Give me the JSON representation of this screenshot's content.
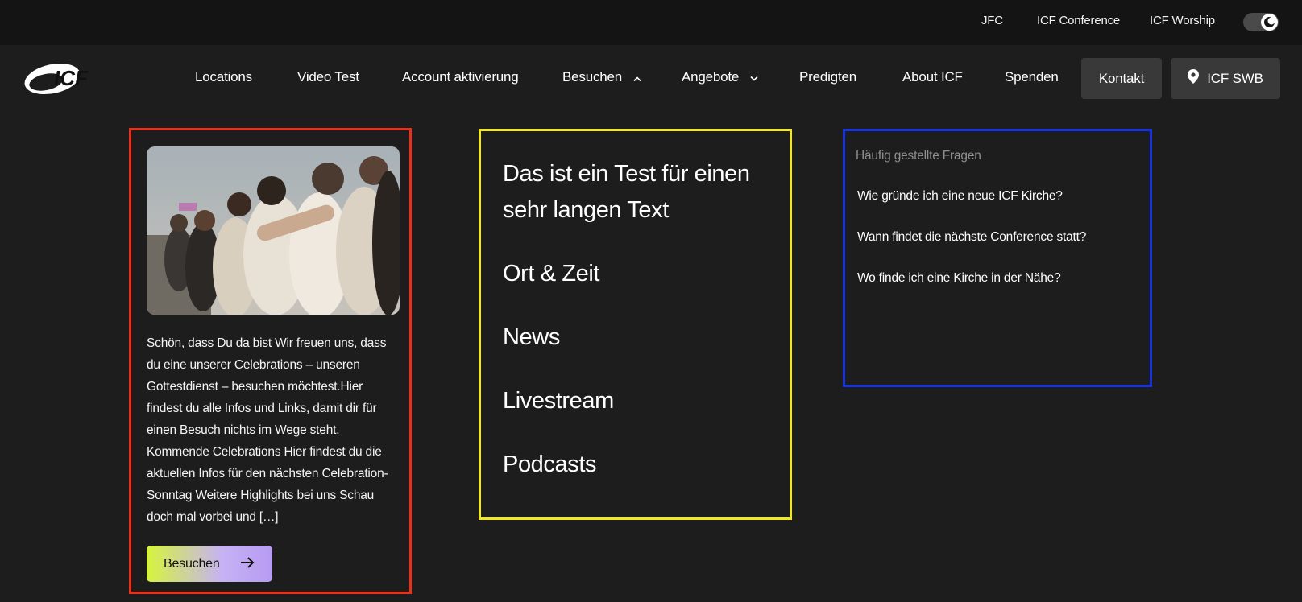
{
  "topbar": {
    "links": [
      "JFC",
      "ICF Conference",
      "ICF Worship"
    ],
    "theme_toggle": "dark-mode-toggle"
  },
  "nav": {
    "logo_text": "ICF",
    "items": [
      "Locations",
      "Video Test",
      "Account aktivierung",
      "Besuchen",
      "Angebote",
      "Predigten",
      "About ICF",
      "Spenden"
    ],
    "kontakt_label": "Kontakt",
    "location_label": "ICF SWB"
  },
  "card": {
    "image_alt": "group-hug-photo",
    "text": "Schön, dass Du da bist Wir freuen uns, dass du eine unserer Celebrations – unseren Gottestdienst – besuchen möchtest.Hier findest du alle Infos und Links, damit dir für einen Besuch nichts im Wege steht. Kommende Celebrations Hier findest du die aktuellen Infos für den nächsten Celebration-Sonntag Weitere Highlights bei uns Schau doch mal vorbei und […]",
    "button_label": "Besuchen"
  },
  "links": [
    "Das ist ein Test für einen sehr langen Text",
    "Ort & Zeit",
    "News",
    "Livestream",
    "Podcasts"
  ],
  "faq": {
    "title": "Häufig gestellte Fragen",
    "items": [
      "Wie gründe ich eine neue ICF Kirche?",
      "Wann findet die nächste Conference statt?",
      "Wo finde ich eine Kirche in der Nähe?"
    ]
  },
  "colors": {
    "highlight_red": "#e8301c",
    "highlight_yellow": "#f2e822",
    "highlight_blue": "#1432e6",
    "button_gradient_start": "#d6f53b",
    "button_gradient_end": "#b79bf2"
  }
}
